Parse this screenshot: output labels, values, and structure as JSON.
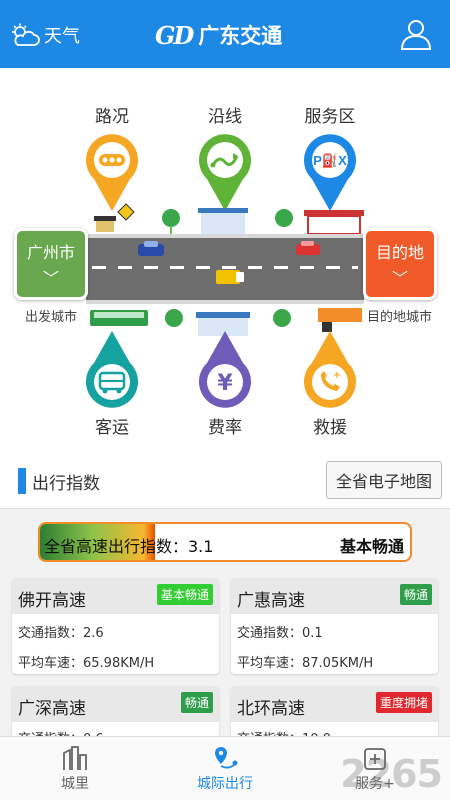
{
  "header": {
    "weather_label": "天气",
    "brand_logo": "GD",
    "title": "广东交通",
    "icons": {
      "weather": "cloud-sun-icon",
      "user": "user-icon"
    }
  },
  "hero": {
    "top_pins": [
      {
        "label": "路况",
        "icon": "traffic-dots-icon",
        "color": "#f5a623"
      },
      {
        "label": "沿线",
        "icon": "route-icon",
        "color": "#5fb336"
      },
      {
        "label": "服务区",
        "icon": "service-area-icon",
        "color": "#1e88e5"
      }
    ],
    "bottom_pins": [
      {
        "label": "客运",
        "icon": "bus-icon",
        "color": "#17a2a2"
      },
      {
        "label": "费率",
        "icon": "yen-icon",
        "color": "#6f5cb8"
      },
      {
        "label": "救援",
        "icon": "phone-icon",
        "color": "#f5a623"
      }
    ],
    "start_city": {
      "name": "广州市",
      "caption": "出发城市"
    },
    "end_city": {
      "name": "目的地",
      "caption": "目的地城市"
    }
  },
  "travel_index": {
    "section_title": "出行指数",
    "map_button": "全省电子地图",
    "overall_text": "全省高速出行指数：3.1",
    "overall_status": "基本畅通",
    "overall_fill_fraction": 0.31,
    "cards": [
      {
        "name": "佛开高速",
        "badge": "基本畅通",
        "badge_color": "#32cd32",
        "index": "交通指数：2.6",
        "speed": "平均车速：65.98KM/H"
      },
      {
        "name": "广惠高速",
        "badge": "畅通",
        "badge_color": "#2e9e4a",
        "index": "交通指数：0.1",
        "speed": "平均车速：87.05KM/H"
      },
      {
        "name": "广深高速",
        "badge": "畅通",
        "badge_color": "#2e9e4a",
        "index": "交通指数：0.6",
        "speed": ""
      },
      {
        "name": "北环高速",
        "badge": "重度拥堵",
        "badge_color": "#e0282e",
        "index": "交通指数：10.0",
        "speed": ""
      }
    ]
  },
  "bottom_nav": {
    "items": [
      {
        "label": "城里",
        "icon": "city-buildings-icon"
      },
      {
        "label": "城际出行",
        "icon": "intercity-route-icon"
      },
      {
        "label": "服务+",
        "icon": "service-plus-icon"
      }
    ],
    "active_index": 1
  },
  "watermark": "2265"
}
